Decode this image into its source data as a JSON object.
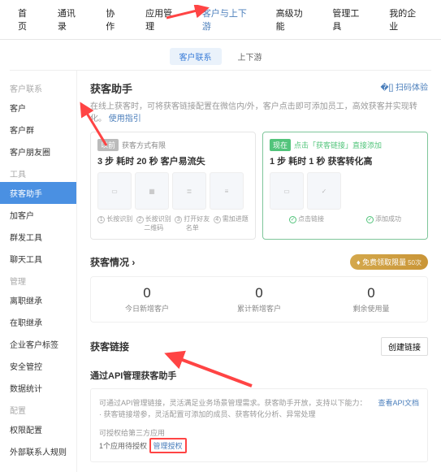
{
  "topnav": [
    "首页",
    "通讯录",
    "协作",
    "应用管理",
    "客户与上下游",
    "高级功能",
    "管理工具",
    "我的企业"
  ],
  "subtabs": [
    "客户联系",
    "上下游"
  ],
  "sidebar": {
    "g1": "客户联系",
    "i1": [
      "客户",
      "客户群",
      "客户朋友圈"
    ],
    "g2": "工具",
    "i2": [
      "获客助手",
      "加客户",
      "群发工具",
      "聊天工具"
    ],
    "g3": "管理",
    "i3": [
      "离职继承",
      "在职继承",
      "企业客户标签",
      "安全管控",
      "数据统计"
    ],
    "g4": "配置",
    "i4": [
      "权限配置",
      "外部联系人规则"
    ]
  },
  "page": {
    "title": "获客助手",
    "sub": "在线上获客时，可将获客链接配置在微信内/外，客户点击即可添加员工，高效获客并实现转化。",
    "guide": "使用指引",
    "scan": "扫码体验"
  },
  "cardA": {
    "badge": "以前",
    "tail": "获客方式有限",
    "title": "3 步 耗时 20 秒 客户易流失",
    "caps": [
      "长按识别",
      "长按识别二维码",
      "打开好友名单",
      "需加进题"
    ]
  },
  "cardB": {
    "badge": "现在",
    "tail": "点击「获客链接」直接添加",
    "title": "1 步 耗时 1 秒 获客转化高",
    "caps": [
      "点击链接",
      "添加成功"
    ]
  },
  "stats": {
    "head": "获客情况",
    "pill": "免费领取限量",
    "pill_n": "50次",
    "items": [
      {
        "n": "0",
        "l": "今日新增客户"
      },
      {
        "n": "0",
        "l": "累计新增客户"
      },
      {
        "n": "0",
        "l": "剩余使用量"
      }
    ]
  },
  "links": {
    "head": "获客链接",
    "btn": "创建链接"
  },
  "api": {
    "title": "通过API管理获客助手",
    "l1": "可通过API管理链接，灵活满足业务场景管理需求。获客助手开放，支持以下能力：",
    "l2": "· 获客链接增参，灵活配置可添加的成员、获客转化分析、异常处理",
    "doc": "查看API文档",
    "row2a": "可授权给第三方应用",
    "row2b": "1个应用待授权",
    "row2c": "管理授权"
  }
}
